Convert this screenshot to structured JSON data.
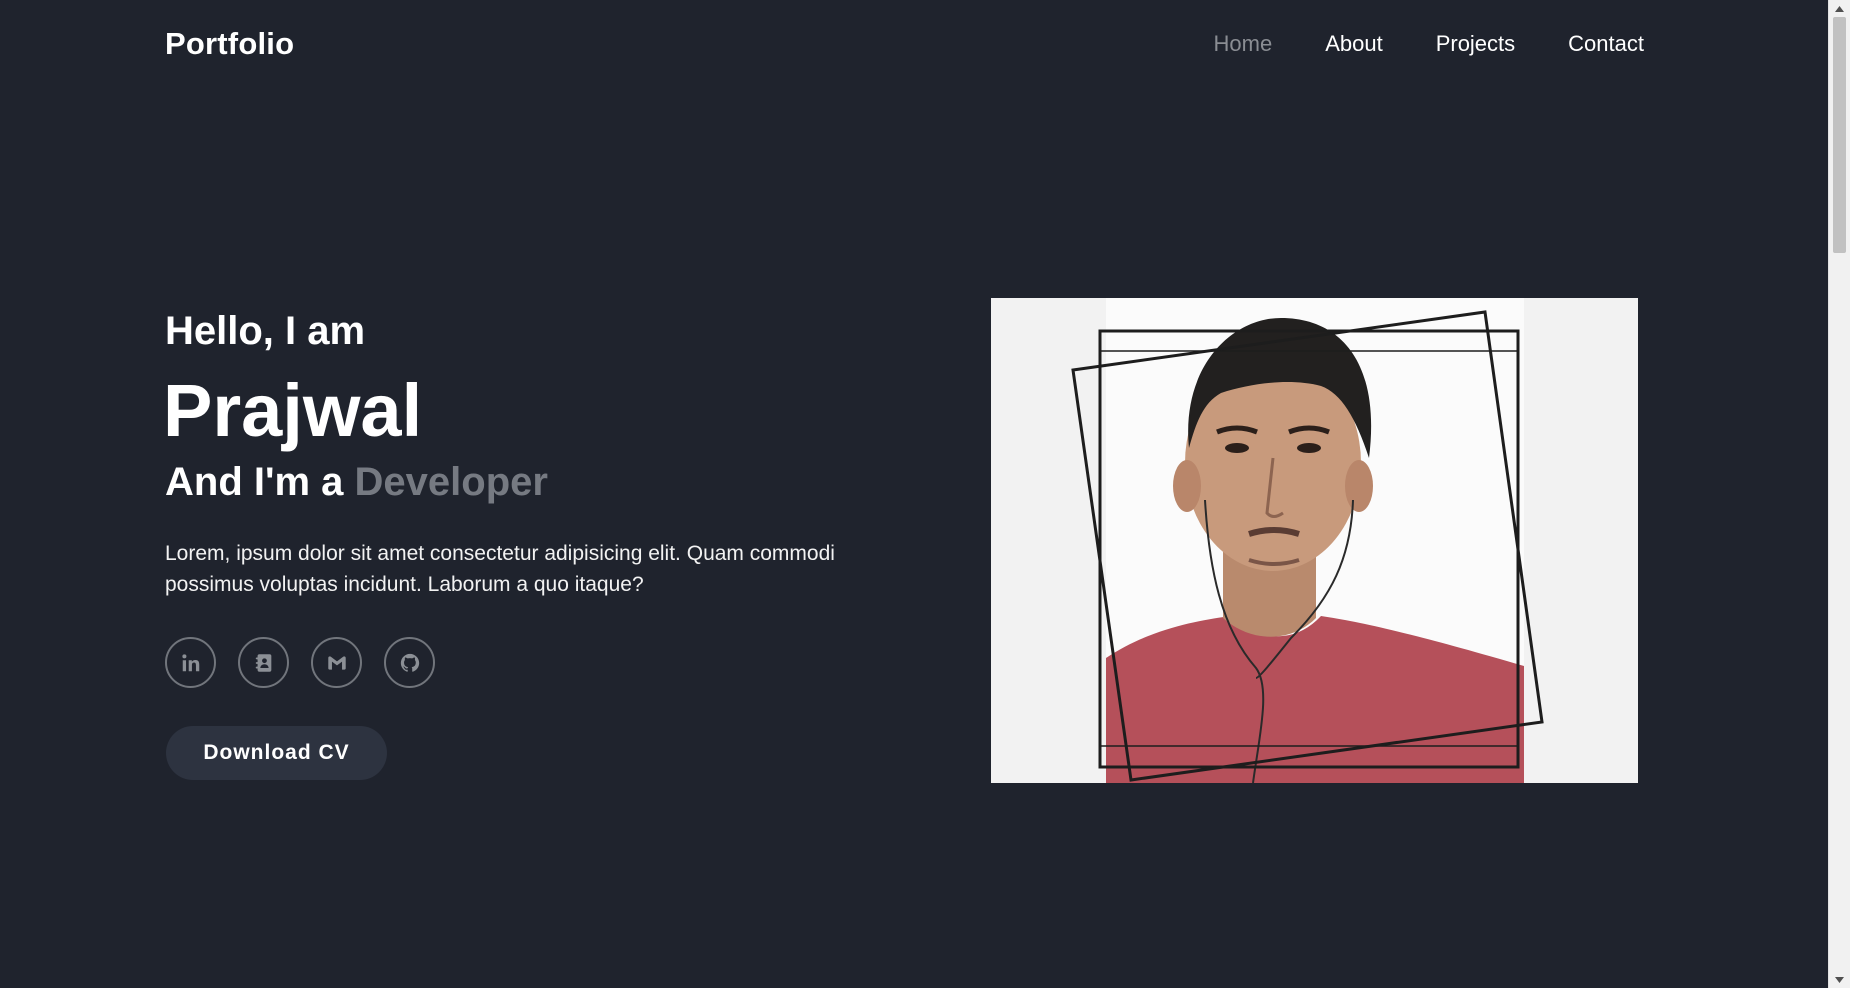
{
  "header": {
    "logo": "Portfolio",
    "nav": [
      {
        "label": "Home",
        "active": true
      },
      {
        "label": "About",
        "active": false
      },
      {
        "label": "Projects",
        "active": false
      },
      {
        "label": "Contact",
        "active": false
      }
    ]
  },
  "hero": {
    "greeting": "Hello, I am",
    "name": "Prajwal",
    "role_prefix": "And I'm a",
    "role_highlight": "Developer",
    "description": "Lorem, ipsum dolor sit amet consectetur adipisicing elit. Quam commodi possimus voluptas incidunt. Laborum a quo itaque?",
    "socials": [
      {
        "icon": "linkedin-icon"
      },
      {
        "icon": "contact-book-icon"
      },
      {
        "icon": "gmail-icon"
      },
      {
        "icon": "github-icon"
      }
    ],
    "cta_label": "Download CV"
  },
  "colors": {
    "background": "#1f232d",
    "accent_text": "#767a82",
    "button_bg": "#2d3340"
  }
}
